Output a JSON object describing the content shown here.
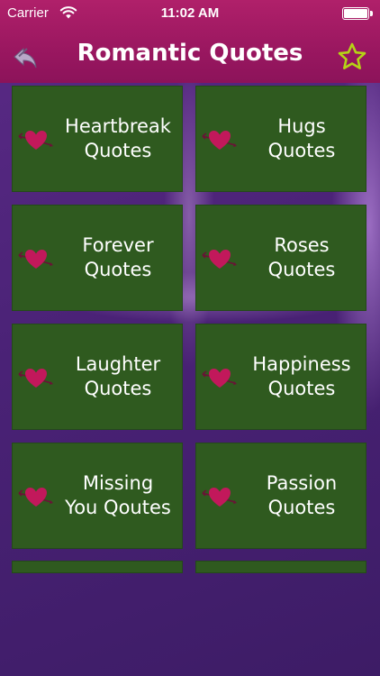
{
  "status_bar": {
    "carrier": "Carrier",
    "time": "11:02 AM"
  },
  "nav": {
    "title": "Romantic Quotes",
    "back_icon": "back-arrow-icon",
    "favorite_icon": "star-outline-icon"
  },
  "tiles": [
    {
      "label": "Heartbreak\nQuotes"
    },
    {
      "label": "Hugs Quotes"
    },
    {
      "label": "Forever\nQuotes"
    },
    {
      "label": "Roses\nQuotes"
    },
    {
      "label": "Laughter\nQuotes"
    },
    {
      "label": "Happiness\nQuotes"
    },
    {
      "label": "Missing\nYou Qoutes"
    },
    {
      "label": "Passion\nQuotes"
    }
  ],
  "colors": {
    "header": "#9a1760",
    "tile": "#2f5a1f",
    "background": "#4b2474",
    "heart": "#c2185b",
    "star": "#b5d316"
  }
}
